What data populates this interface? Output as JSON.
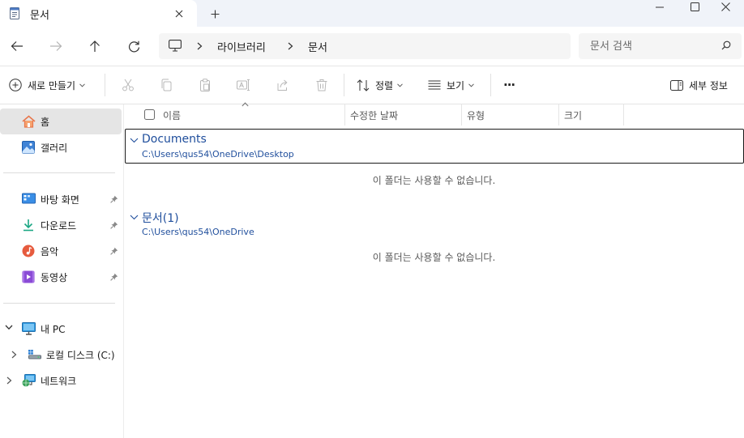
{
  "tab": {
    "title": "문서"
  },
  "address": {
    "crumbs": [
      "라이브러리",
      "문서"
    ]
  },
  "search": {
    "placeholder": "문서 검색"
  },
  "commands": {
    "new_label": "새로 만들기",
    "sort_label": "정렬",
    "view_label": "보기",
    "more_label": "···",
    "details_label": "세부 정보"
  },
  "sidebar": {
    "items": [
      {
        "label": "홈",
        "icon": "home-icon"
      },
      {
        "label": "갤러리",
        "icon": "gallery-icon"
      },
      {
        "label": "바탕 화면",
        "icon": "desktop-folder-icon"
      },
      {
        "label": "다운로드",
        "icon": "download-icon"
      },
      {
        "label": "음악",
        "icon": "music-icon"
      },
      {
        "label": "동영상",
        "icon": "video-icon"
      },
      {
        "label": "내 PC",
        "icon": "pc-icon"
      },
      {
        "label": "로컬 디스크 (C:)",
        "icon": "drive-icon"
      },
      {
        "label": "네트워크",
        "icon": "network-icon"
      }
    ]
  },
  "columns": [
    "이름",
    "수정한 날짜",
    "유형",
    "크기"
  ],
  "groups": [
    {
      "title": "Documents",
      "path": "C:\\Users\\qus54\\OneDrive\\Desktop",
      "empty": "이 폴더는 사용할 수 없습니다."
    },
    {
      "title": "문서(1)",
      "path": "C:\\Users\\qus54\\OneDrive",
      "empty": "이 폴더는 사용할 수 없습니다."
    }
  ],
  "colors": {
    "accent": "#1f4e9c",
    "selected": "#e5e5e5",
    "chrome": "#f0f3f9"
  }
}
